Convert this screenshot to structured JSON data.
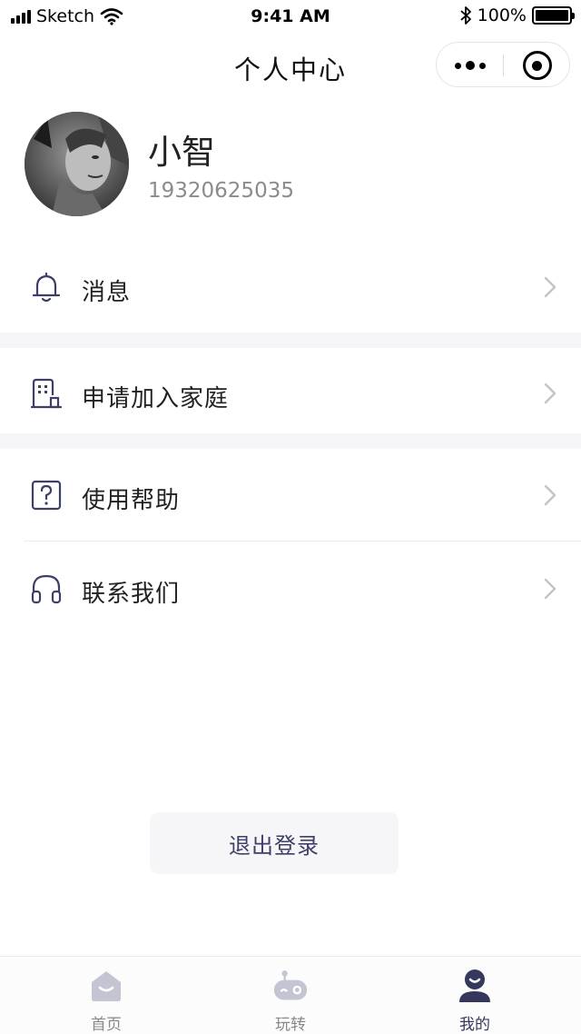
{
  "status_bar": {
    "carrier": "Sketch",
    "time": "9:41 AM",
    "battery": "100%",
    "icons": [
      "signal-icon",
      "wifi-icon",
      "bluetooth-icon",
      "battery-icon"
    ]
  },
  "nav": {
    "title": "个人中心",
    "capsule": {
      "icons": [
        "more-icon",
        "close-miniprogram-icon"
      ]
    }
  },
  "profile": {
    "name": "小智",
    "phone": "19320625035"
  },
  "menu": {
    "items": [
      {
        "label": "消息",
        "icon": "bell-icon"
      },
      {
        "label": "申请加入家庭",
        "icon": "building-icon"
      },
      {
        "label": "使用帮助",
        "icon": "help-icon"
      },
      {
        "label": "联系我们",
        "icon": "headset-icon"
      }
    ]
  },
  "logout": {
    "label": "退出登录"
  },
  "tabbar": {
    "tabs": [
      {
        "label": "首页",
        "icon": "home-icon",
        "active": false
      },
      {
        "label": "玩转",
        "icon": "robot-icon",
        "active": false
      },
      {
        "label": "我的",
        "icon": "user-icon",
        "active": true
      }
    ]
  },
  "colors": {
    "accent": "#35375c",
    "icon_stroke": "#3d3f66",
    "inactive_icon": "#c3c5d3",
    "section_gap": "#f5f5f8"
  }
}
